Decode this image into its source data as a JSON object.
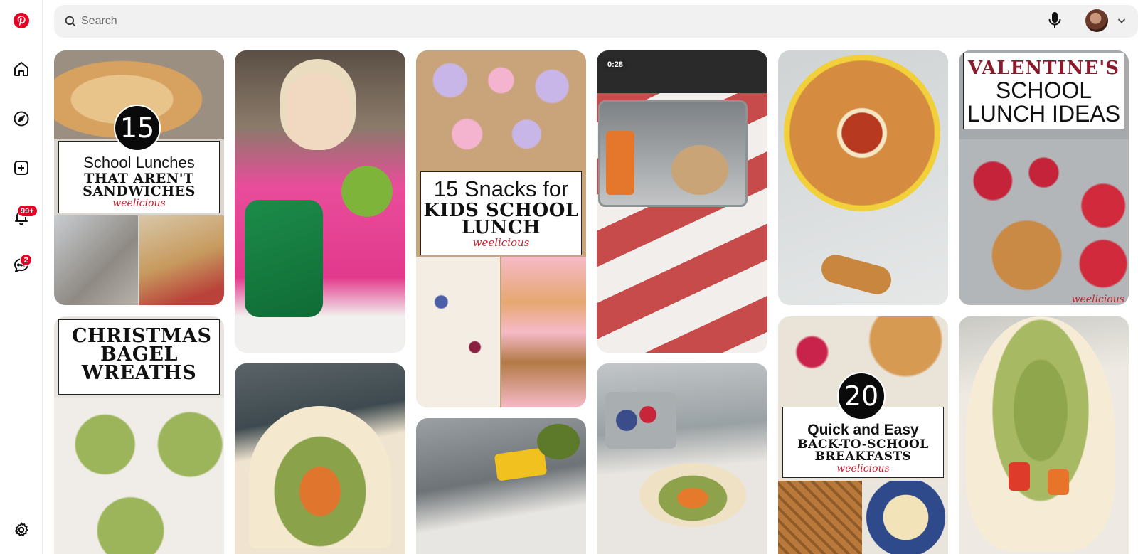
{
  "header": {
    "search_placeholder": "Search"
  },
  "sidebar": {
    "notifications_badge": "99+",
    "messages_badge": "2"
  },
  "pins": {
    "p1": {
      "number": "15",
      "line1": "School Lunches",
      "line2": "THAT AREN'T SANDWICHES",
      "brand": "weelicious"
    },
    "p3": {
      "line1": "15 Snacks for",
      "line2": "KIDS SCHOOL LUNCH",
      "brand": "weelicious"
    },
    "p4": {
      "duration": "0:28"
    },
    "p6": {
      "line1": "VALENTINE'S",
      "line2": "SCHOOL LUNCH IDEAS",
      "brand": "weelicious"
    },
    "p7": {
      "title": "CHRISTMAS BAGEL WREATHS"
    },
    "p11": {
      "number": "20",
      "line1": "Quick and Easy",
      "line2": "BACK-TO-SCHOOL BREAKFASTS",
      "brand": "weelicious"
    }
  },
  "colors": {
    "brand_red": "#e60023"
  }
}
